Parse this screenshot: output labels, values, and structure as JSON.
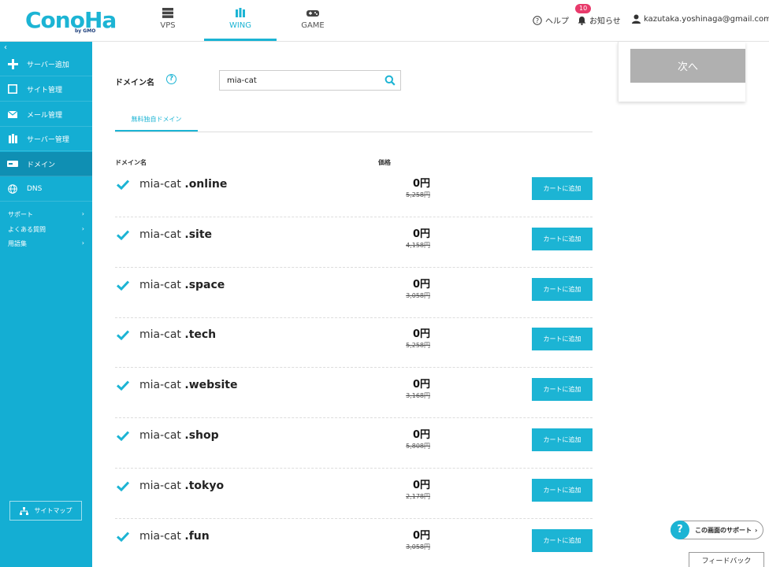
{
  "header": {
    "logo_text": "ConoHa",
    "logo_sub": "by GMO",
    "tabs": [
      {
        "label": "VPS",
        "icon": "server-icon"
      },
      {
        "label": "WING",
        "icon": "wing-icon",
        "active": true
      },
      {
        "label": "GAME",
        "icon": "gamepad-icon"
      }
    ],
    "help_label": "ヘルプ",
    "notice_label": "お知らせ",
    "notice_count": "10",
    "user_email": "kazutaka.yoshinaga@gmail.com"
  },
  "sidebar": {
    "collapse_glyph": "‹",
    "items": [
      {
        "label": "サーバー追加",
        "icon": "plus-icon"
      },
      {
        "label": "サイト管理",
        "icon": "window-icon"
      },
      {
        "label": "メール管理",
        "icon": "mail-icon"
      },
      {
        "label": "サーバー管理",
        "icon": "server-manage-icon"
      },
      {
        "label": "ドメイン",
        "icon": "domain-icon",
        "active": true
      },
      {
        "label": "DNS",
        "icon": "globe-icon"
      }
    ],
    "links": [
      {
        "label": "サポート",
        "arrow": "›"
      },
      {
        "label": "よくある質問",
        "arrow": "›"
      },
      {
        "label": "用語集",
        "arrow": "›"
      }
    ],
    "sitemap_label": "サイトマップ"
  },
  "search": {
    "label": "ドメイン名",
    "help": "?",
    "value": "mia-cat"
  },
  "subtab": {
    "label": "無料独自ドメイン"
  },
  "columns": {
    "domain": "ドメイン名",
    "price": "価格"
  },
  "domains": [
    {
      "base": "mia-cat ",
      "tld": ".online",
      "price": "0円",
      "original": "5,258円",
      "button": "カートに追加"
    },
    {
      "base": "mia-cat ",
      "tld": ".site",
      "price": "0円",
      "original": "4,158円",
      "button": "カートに追加"
    },
    {
      "base": "mia-cat ",
      "tld": ".space",
      "price": "0円",
      "original": "3,058円",
      "button": "カートに追加"
    },
    {
      "base": "mia-cat ",
      "tld": ".tech",
      "price": "0円",
      "original": "5,258円",
      "button": "カートに追加"
    },
    {
      "base": "mia-cat ",
      "tld": ".website",
      "price": "0円",
      "original": "3,168円",
      "button": "カートに追加"
    },
    {
      "base": "mia-cat ",
      "tld": ".shop",
      "price": "0円",
      "original": "5,808円",
      "button": "カートに追加"
    },
    {
      "base": "mia-cat ",
      "tld": ".tokyo",
      "price": "0円",
      "original": "2,178円",
      "button": "カートに追加"
    },
    {
      "base": "mia-cat ",
      "tld": ".fun",
      "price": "0円",
      "original": "3,058円",
      "button": "カートに追加"
    }
  ],
  "right_panel": {
    "next_label": "次へ"
  },
  "support": {
    "label": "この画面のサポート",
    "arrow": "›",
    "q": "?"
  },
  "feedback": {
    "label": "フィードバック"
  },
  "colors": {
    "accent": "#1cb4d4",
    "sidebar": "#14aed3",
    "badge": "#e83a6b",
    "next_disabled": "#b0b0b0"
  }
}
